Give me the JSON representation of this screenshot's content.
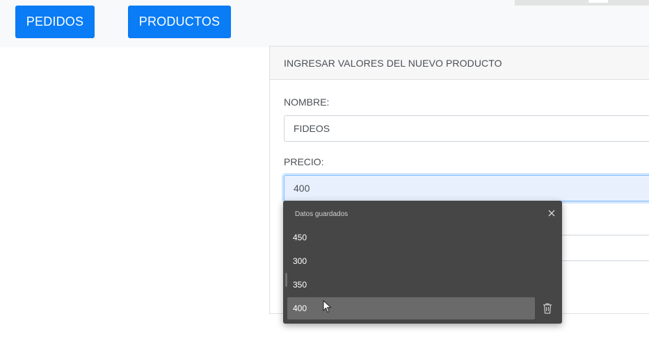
{
  "nav": {
    "pedidos_label": "PEDIDOS",
    "productos_label": "PRODUCTOS"
  },
  "form": {
    "header": "INGRESAR VALORES DEL NUEVO PRODUCTO",
    "nombre_label": "NOMBRE:",
    "nombre_value": "FIDEOS",
    "precio_label": "PRECIO:",
    "precio_value": "400"
  },
  "autocomplete": {
    "title": "Datos guardados",
    "items": [
      "450",
      "300",
      "350",
      "400"
    ],
    "selected_index": 3
  },
  "colors": {
    "primary": "#0a7cf5",
    "dropdown_bg": "#464646",
    "autofill_bg": "#e8f0fe"
  },
  "icons": {
    "close": "close-icon",
    "delete": "trash-icon",
    "pointer": "mouse-cursor"
  }
}
